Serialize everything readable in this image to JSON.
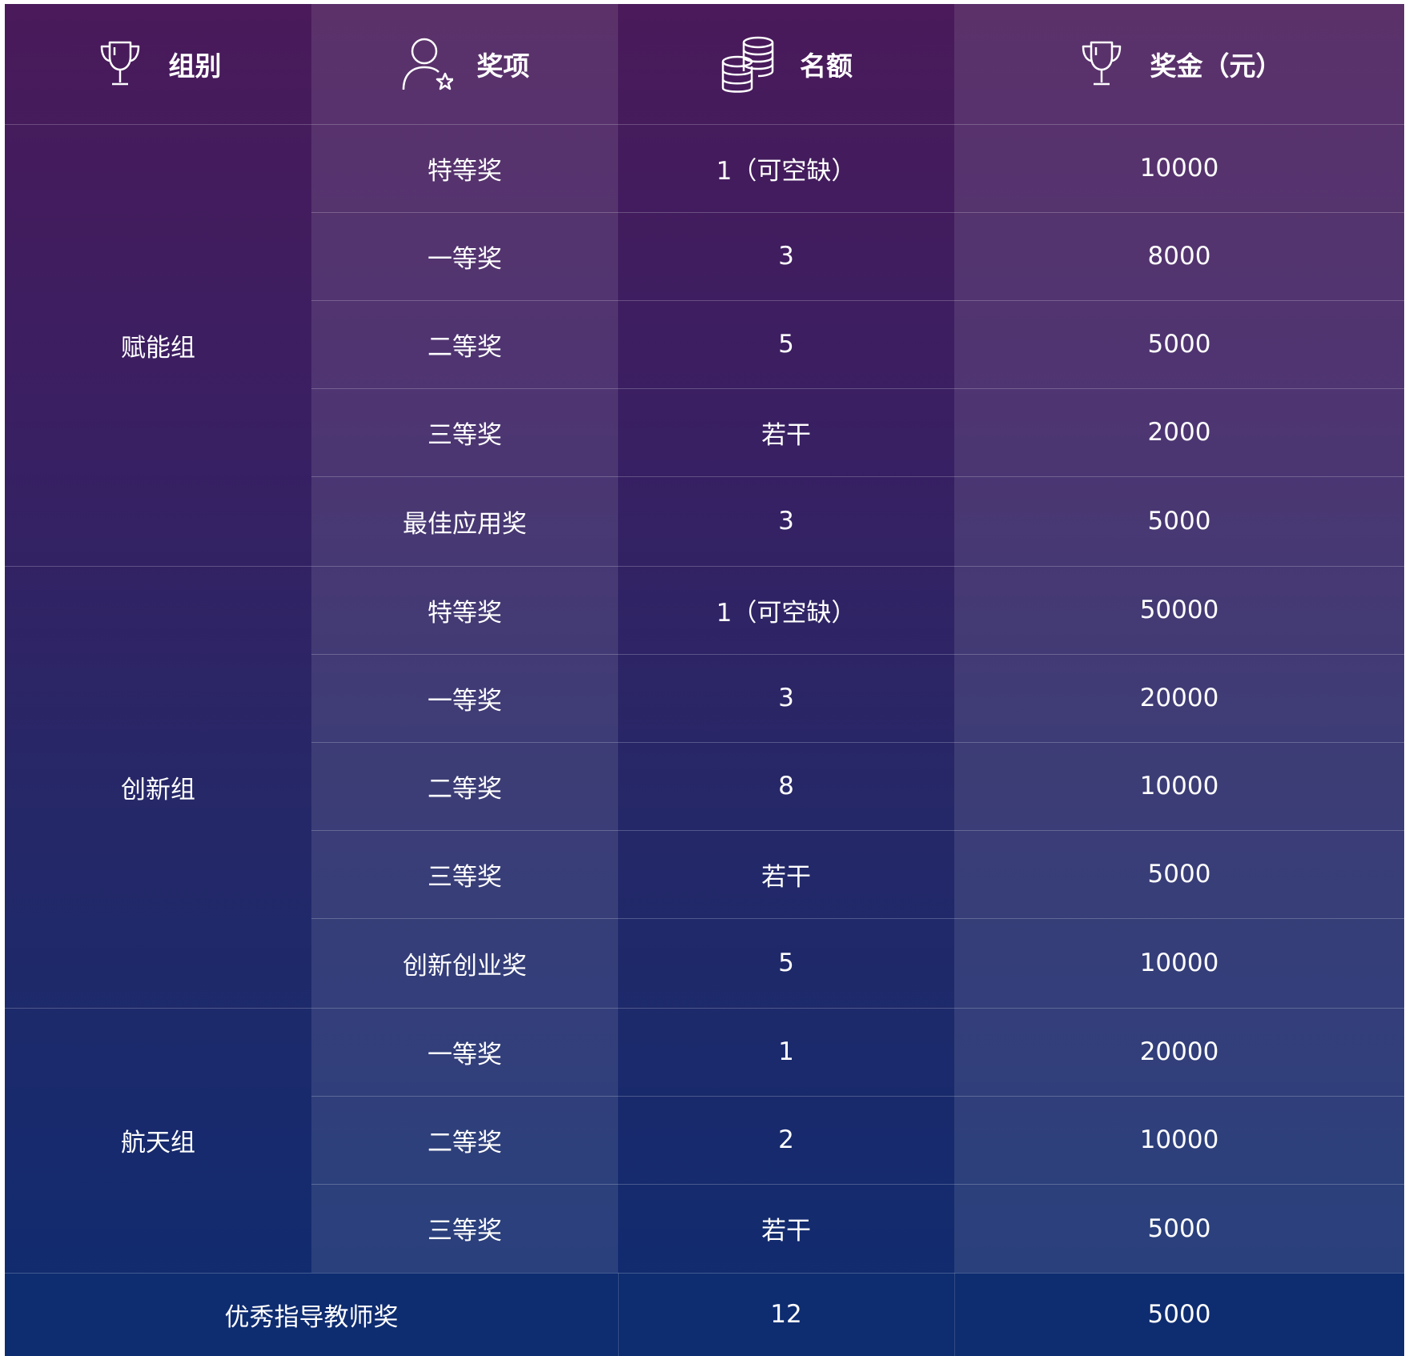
{
  "header": {
    "group": {
      "label": "组别",
      "icon": "trophy-icon"
    },
    "award": {
      "label": "奖项",
      "icon": "user-star-icon"
    },
    "quota": {
      "label": "名额",
      "icon": "coins-icon"
    },
    "prize": {
      "label": "奖金（元）",
      "icon": "trophy-icon"
    }
  },
  "groups": [
    {
      "name": "赋能组",
      "rows": [
        {
          "award": "特等奖",
          "quota": "1（可空缺）",
          "prize": "10000"
        },
        {
          "award": "一等奖",
          "quota": "3",
          "prize": "8000"
        },
        {
          "award": "二等奖",
          "quota": "5",
          "prize": "5000"
        },
        {
          "award": "三等奖",
          "quota": "若干",
          "prize": "2000"
        },
        {
          "award": "最佳应用奖",
          "quota": "3",
          "prize": "5000"
        }
      ]
    },
    {
      "name": "创新组",
      "rows": [
        {
          "award": "特等奖",
          "quota": "1（可空缺）",
          "prize": "50000"
        },
        {
          "award": "一等奖",
          "quota": "3",
          "prize": "20000"
        },
        {
          "award": "二等奖",
          "quota": "8",
          "prize": "10000"
        },
        {
          "award": "三等奖",
          "quota": "若干",
          "prize": "5000"
        },
        {
          "award": "创新创业奖",
          "quota": "5",
          "prize": "10000"
        }
      ]
    },
    {
      "name": "航天组",
      "rows": [
        {
          "award": "一等奖",
          "quota": "1",
          "prize": "20000"
        },
        {
          "award": "二等奖",
          "quota": "2",
          "prize": "10000"
        },
        {
          "award": "三等奖",
          "quota": "若干",
          "prize": "5000"
        }
      ]
    }
  ],
  "footer": {
    "award": "优秀指导教师奖",
    "quota": "12",
    "prize": "5000"
  }
}
